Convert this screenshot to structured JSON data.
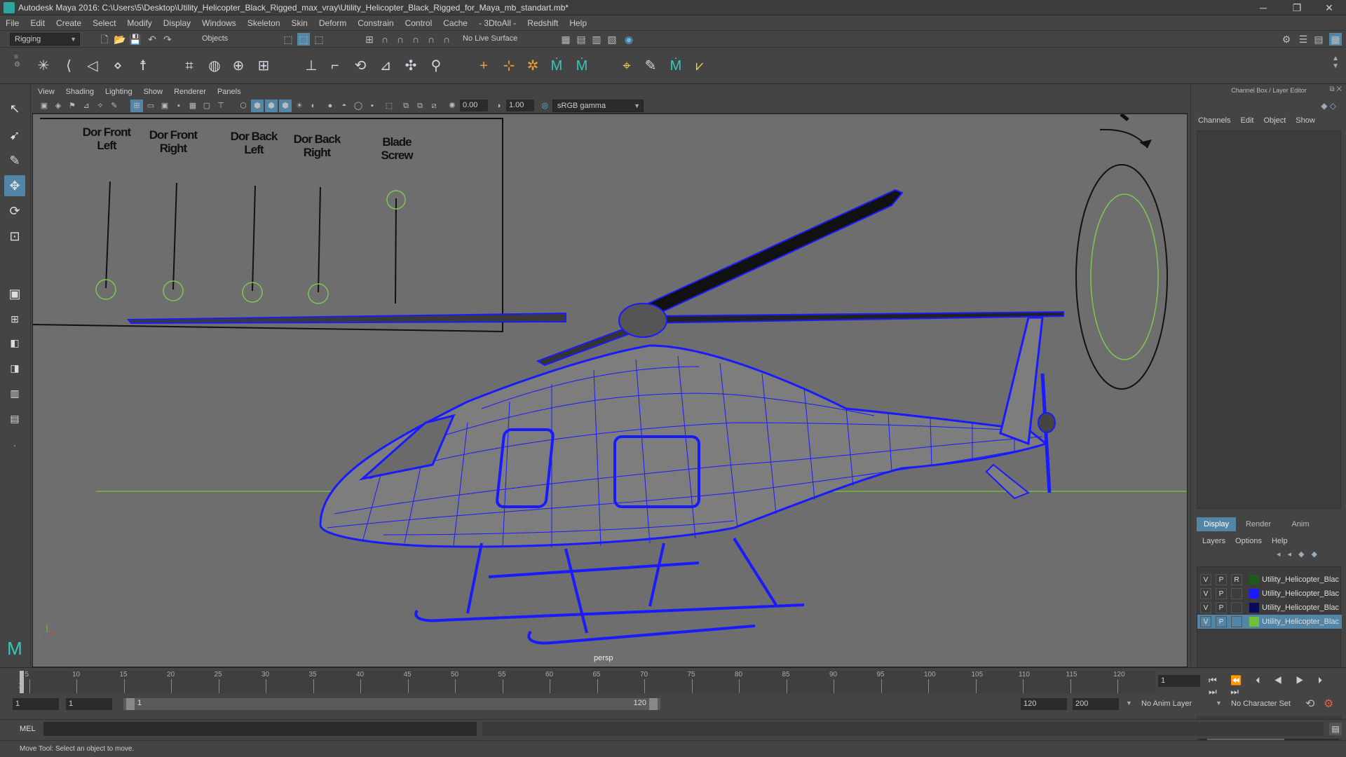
{
  "window": {
    "title": "Autodesk Maya 2016: C:\\Users\\5\\Desktop\\Utility_Helicopter_Black_Rigged_max_vray\\Utility_Helicopter_Black_Rigged_for_Maya_mb_standart.mb*",
    "minimize": "─",
    "restore": "❐",
    "close": "✕"
  },
  "menubar": [
    "File",
    "Edit",
    "Create",
    "Select",
    "Modify",
    "Display",
    "Windows",
    "Skeleton",
    "Skin",
    "Deform",
    "Constrain",
    "Control",
    "Cache",
    "- 3DtoAll -",
    "Redshift",
    "Help"
  ],
  "statusline": {
    "menuset": "Rigging",
    "selection_mode": "Objects",
    "live_surface": "No Live Surface"
  },
  "panel_menu": [
    "View",
    "Shading",
    "Lighting",
    "Show",
    "Renderer",
    "Panels"
  ],
  "panel_toolbar": {
    "exposure": "0.00",
    "gamma": "1.00",
    "color_space": "sRGB gamma"
  },
  "viewport": {
    "camera": "persp",
    "controls": [
      {
        "label": "Dor Front\nLeft"
      },
      {
        "label": "Dor Front\nRight"
      },
      {
        "label": "Dor Back\nLeft"
      },
      {
        "label": "Dor Back\nRight"
      },
      {
        "label": "Blade\nScrew"
      }
    ],
    "wire_color": "#1a1aff",
    "ctrl_color": "#7ec850"
  },
  "channel_box": {
    "title": "Channel Box / Layer Editor",
    "menu": [
      "Channels",
      "Edit",
      "Object",
      "Show"
    ]
  },
  "layer_editor": {
    "tabs": [
      "Display",
      "Render",
      "Anim"
    ],
    "active_tab": "Display",
    "menu": [
      "Layers",
      "Options",
      "Help"
    ],
    "layers": [
      {
        "v": "V",
        "p": "P",
        "r": "R",
        "color": "#1e5a1e",
        "name": "Utility_Helicopter_Blac",
        "selected": false
      },
      {
        "v": "V",
        "p": "P",
        "r": "",
        "color": "#1a1aff",
        "name": "Utility_Helicopter_Blac",
        "selected": false
      },
      {
        "v": "V",
        "p": "P",
        "r": "",
        "color": "#0a0a5a",
        "name": "Utility_Helicopter_Blac",
        "selected": false
      },
      {
        "v": "V",
        "p": "P",
        "r": "",
        "color": "#6fbf3a",
        "name": "Utility_Helicopter_Blac",
        "selected": true
      }
    ]
  },
  "timeline": {
    "ticks": [
      "5",
      "10",
      "15",
      "20",
      "25",
      "30",
      "35",
      "40",
      "45",
      "50",
      "55",
      "60",
      "65",
      "70",
      "75",
      "80",
      "85",
      "90",
      "95",
      "100",
      "105",
      "110",
      "115",
      "120"
    ],
    "start_tick": "1",
    "current_frame": "1"
  },
  "range": {
    "start": "1",
    "playback_start": "1",
    "slider_start": "1",
    "slider_end": "120",
    "playback_end": "120",
    "end": "200",
    "anim_layer": "No Anim Layer",
    "character_set": "No Character Set"
  },
  "cmdline": {
    "label": "MEL"
  },
  "helpline": {
    "text": "Move Tool: Select an object to move."
  }
}
